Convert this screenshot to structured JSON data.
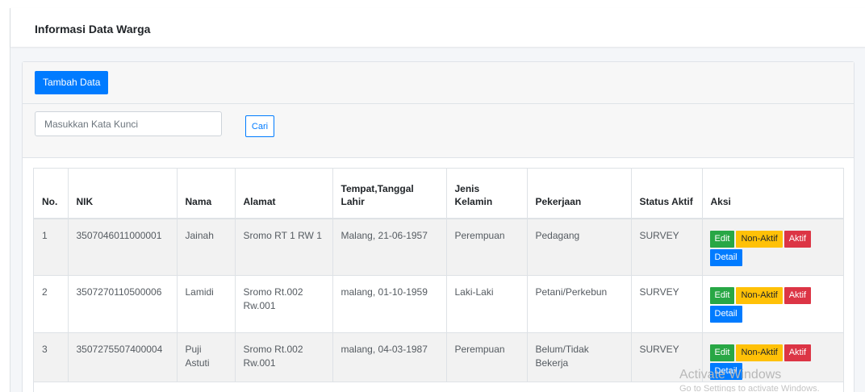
{
  "header": {
    "title": "Informasi Data Warga"
  },
  "toolbar": {
    "add_label": "Tambah Data"
  },
  "search": {
    "placeholder": "Masukkan Kata Kunci",
    "button_label": "Cari"
  },
  "table": {
    "columns": {
      "no": "No.",
      "nik": "NIK",
      "nama": "Nama",
      "alamat": "Alamat",
      "ttl": "Tempat,Tanggal Lahir",
      "jk": "Jenis Kelamin",
      "pekerjaan": "Pekerjaan",
      "status": "Status Aktif",
      "aksi": "Aksi"
    },
    "rows": [
      {
        "no": "1",
        "nik": "3507046011000001",
        "nama": "Jainah",
        "alamat": "Sromo RT 1 RW 1",
        "ttl": "Malang, 21-06-1957",
        "jk": "Perempuan",
        "pekerjaan": "Pedagang",
        "status": "SURVEY"
      },
      {
        "no": "2",
        "nik": "3507270110500006",
        "nama": "Lamidi",
        "alamat": "Sromo Rt.002 Rw.001",
        "ttl": "malang, 01-10-1959",
        "jk": "Laki-Laki",
        "pekerjaan": "Petani/Perkebun",
        "status": "SURVEY"
      },
      {
        "no": "3",
        "nik": "3507275507400004",
        "nama": "Puji Astuti",
        "alamat": "Sromo Rt.002 Rw.001",
        "ttl": "malang, 04-03-1987",
        "jk": "Perempuan",
        "pekerjaan": "Belum/Tidak Bekerja",
        "status": "SURVEY"
      }
    ],
    "actions": {
      "edit": "Edit",
      "nonaktif": "Non-Aktif",
      "aktif": "Aktif",
      "detail": "Detail"
    }
  },
  "watermark": {
    "line1": "Activate Windows",
    "line2": "Go to Settings to activate Windows."
  },
  "colors": {
    "primary": "#007bff",
    "success": "#28a745",
    "warning": "#ffc107",
    "danger": "#dc3545"
  }
}
